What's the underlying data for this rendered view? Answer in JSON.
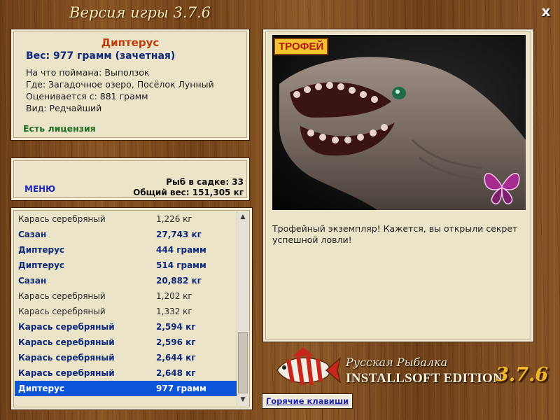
{
  "window": {
    "title": "Версия игры 3.7.6",
    "close_label": "x"
  },
  "fish": {
    "name": "Диптерус",
    "weight": "Вес: 977 грамм (зачетная)",
    "caught_with": "На что поймана: Выползок",
    "location": "Где: Загадочное озеро, Посёлок Лунный",
    "valued_from": "Оценивается с: 881 грамм",
    "rarity": "Вид: Редчайший",
    "license": "Есть лицензия"
  },
  "cage": {
    "menu_label": "МЕНЮ",
    "fish_count": "Рыб в садке: 33",
    "total_weight": "Общий вес: 151,305 кг"
  },
  "catch_list": [
    {
      "name": "Карась серебряный",
      "weight": "1,226 кг",
      "bold": false
    },
    {
      "name": "Сазан",
      "weight": "27,743 кг",
      "bold": true
    },
    {
      "name": "Диптерус",
      "weight": "444 грамм",
      "bold": true
    },
    {
      "name": "Диптерус",
      "weight": "514 грамм",
      "bold": true
    },
    {
      "name": "Сазан",
      "weight": "20,882 кг",
      "bold": true
    },
    {
      "name": "Карась серебряный",
      "weight": "1,202 кг",
      "bold": false
    },
    {
      "name": "Карась серебряный",
      "weight": "1,332 кг",
      "bold": false
    },
    {
      "name": "Карась серебряный",
      "weight": "2,594 кг",
      "bold": true
    },
    {
      "name": "Карась серебряный",
      "weight": "2,596 кг",
      "bold": true
    },
    {
      "name": "Карась серебряный",
      "weight": "2,644 кг",
      "bold": true
    },
    {
      "name": "Карась серебряный",
      "weight": "2,648 кг",
      "bold": true
    },
    {
      "name": "Диптерус",
      "weight": "977 грамм",
      "bold": true,
      "selected": true
    }
  ],
  "photo": {
    "badge": "ТРОФЕЙ",
    "caption": "Трофейный экземпляр! Кажется, вы открыли секрет успешной ловли!"
  },
  "footer": {
    "hotkeys_label": "Горячие клавиши",
    "brand_line1": "Русская Рыбалка",
    "brand_line2": "INSTALLSOFT EDITION",
    "brand_version": "3.7.6"
  },
  "colors": {
    "wood": "#7a4a1c",
    "panel": "#ece4c9",
    "name_red": "#c0390b",
    "bold_blue": "#0f2a7c",
    "license_green": "#1e6b22",
    "selection": "#0c55d9",
    "version_gold": "#f0b72c"
  }
}
